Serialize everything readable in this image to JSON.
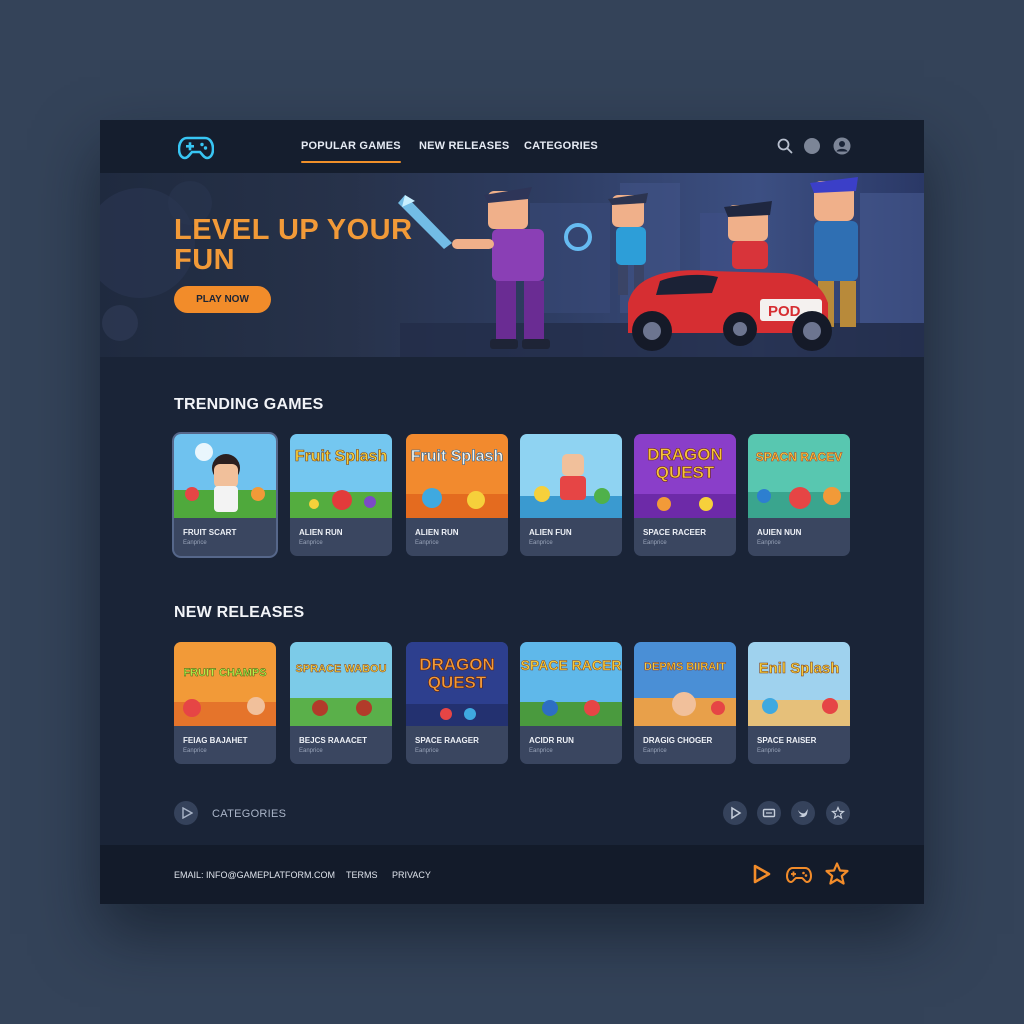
{
  "header": {
    "logo_icon": "gamepad-icon",
    "nav": [
      {
        "label": "POPULAR GAMES",
        "active": true
      },
      {
        "label": "NEW RELEASES",
        "active": false
      },
      {
        "label": "CATEGORIES",
        "active": false
      }
    ],
    "actions": [
      "search-icon",
      "notification-dot-icon",
      "user-icon"
    ]
  },
  "hero": {
    "title": "LEVEL UP YOUR FUN",
    "button": "PLAY NOW"
  },
  "trending": {
    "title": "TRENDING GAMES",
    "cards": [
      {
        "title": "FRUIT SCART",
        "sub": "Eanprice",
        "thumb_text": ""
      },
      {
        "title": "ALIEN RUN",
        "sub": "Eanprice",
        "thumb_text": "Fruit Splash"
      },
      {
        "title": "ALIEN RUN",
        "sub": "Eanprice",
        "thumb_text": "Fruit Splash"
      },
      {
        "title": "ALIEN FUN",
        "sub": "Eanprice",
        "thumb_text": ""
      },
      {
        "title": "SPACE RACEER",
        "sub": "Eanprice",
        "thumb_text": "DRAGON QUEST"
      },
      {
        "title": "AUIEN NUN",
        "sub": "Eanprice",
        "thumb_text": "SPACN RACEV"
      }
    ]
  },
  "new_releases": {
    "title": "NEW RELEASES",
    "cards": [
      {
        "title": "FEIAG BAJAHET",
        "sub": "Eanprice",
        "thumb_text": "FRUIT CHAMPS"
      },
      {
        "title": "BEJCS RAAACET",
        "sub": "Eanprice",
        "thumb_text": "SPRACE WABOU"
      },
      {
        "title": "SPACE RAAGER",
        "sub": "Eanprice",
        "thumb_text": "DRAGON QUEST"
      },
      {
        "title": "ACIDR RUN",
        "sub": "Eanprice",
        "thumb_text": "SPACE RACER"
      },
      {
        "title": "DRAGIG CHOGER",
        "sub": "Eanprice",
        "thumb_text": "DEPMS BIIRAIT"
      },
      {
        "title": "SPACE RAISER",
        "sub": "Eanprice",
        "thumb_text": "Enil Splash"
      }
    ]
  },
  "categories_bar": {
    "label": "CATEGORIES",
    "social_icons": [
      "play-icon",
      "ticket-icon",
      "bird-icon",
      "star-icon"
    ]
  },
  "footer": {
    "email": "EMAIL: INFO@GAMEPLATFORM.COM",
    "terms": "TERMS",
    "privacy": "PRIVACY",
    "icons": [
      "play-icon",
      "gamepad-icon",
      "star-icon"
    ]
  },
  "colors": {
    "accent": "#f28c2a",
    "page_bg": "#344359",
    "panel_bg": "#1a2437",
    "card_bg": "#3a4660",
    "logo": "#38c6f4"
  }
}
